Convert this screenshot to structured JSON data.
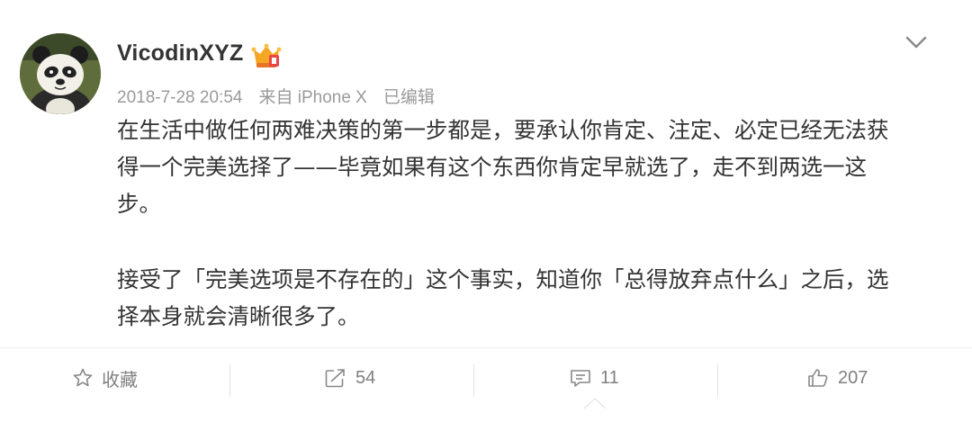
{
  "post": {
    "username": "VicodinXYZ",
    "timestamp": "2018-7-28 20:54",
    "source": "来自 iPhone X",
    "edited": "已编辑",
    "paragraphs": [
      {
        "lines": [
          "在生活中做任何两难决策的第一步都是，要承认你肯定、注定、必定已经无法获",
          "得一个完美选择了——毕竟如果有这个东西你肯定早就选了，走不到两选一这",
          "步。"
        ]
      },
      {
        "lines": [
          "接受了「完美选项是不存在的」这个事实，知道你「总得放弃点什么」之后，选",
          "择本身就会清晰很多了。"
        ]
      }
    ]
  },
  "actions": {
    "favorite": {
      "label": "收藏",
      "icon": "star-icon"
    },
    "repost": {
      "count": "54",
      "icon": "repost-icon"
    },
    "comment": {
      "count": "11",
      "icon": "comment-icon"
    },
    "like": {
      "count": "207",
      "icon": "thumbs-up-icon"
    }
  },
  "colors": {
    "text": "#333333",
    "meta": "#9a9a9a",
    "action": "#808080",
    "divider": "#eeeeee"
  }
}
